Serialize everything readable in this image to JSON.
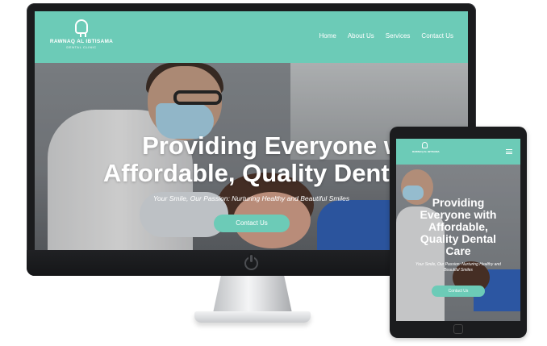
{
  "desktop": {
    "logo": {
      "name": "RAWNAQ AL IBTISAMA",
      "subtitle": "DENTAL CLINIC",
      "icon": "tooth-icon"
    },
    "nav": {
      "home": "Home",
      "about": "About Us",
      "services": "Services",
      "contact": "Contact Us"
    },
    "hero": {
      "title": "Providing Everyone with\nAffordable, Quality Dental Care",
      "tagline": "Your Smile, Our Passion: Nurturing Healthy and Beautiful Smiles",
      "cta": "Contact Us"
    }
  },
  "tablet": {
    "logo": {
      "name": "RAWNAQ AL IBTISAMA",
      "icon": "tooth-icon"
    },
    "menu_icon": "hamburger-menu-icon",
    "hero": {
      "title": "Providing\nEveryone with\nAffordable,\nQuality Dental\nCare",
      "tagline": "Your Smile, Our Passion: Nurturing Healthy and Beautiful Smiles",
      "cta": "Contact Us"
    }
  },
  "colors": {
    "brand_teal": "#6ccbb7",
    "device_frame": "#1b1c1e",
    "chair_blue": "#2d5fb8"
  }
}
